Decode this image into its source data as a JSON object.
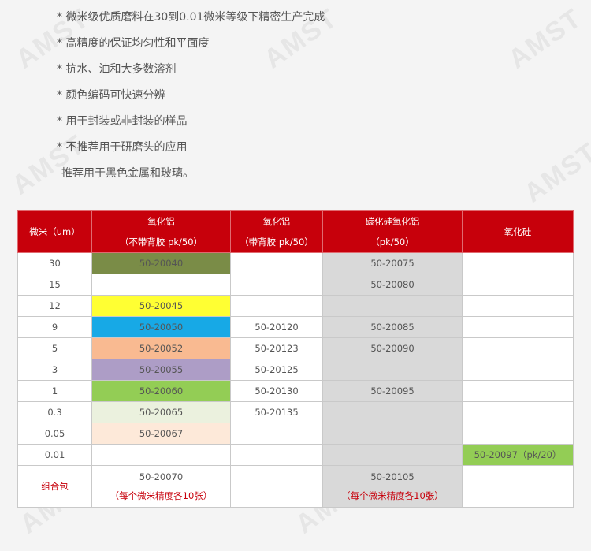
{
  "watermark": "AMST",
  "features": [
    "* 微米级优质磨料在30到0.01微米等级下精密生产完成",
    "* 高精度的保证均匀性和平面度",
    "* 抗水、油和大多数溶剂",
    "* 颜色编码可快速分辨",
    "* 用于封装或非封装的样品",
    "* 不推荐用于研磨头的应用",
    "推荐用于黑色金属和玻璃。"
  ],
  "table": {
    "headers": {
      "micron": "微米（um）",
      "alumina_nobacking_line1": "氧化铝",
      "alumina_nobacking_line2": "（不带背胶 pk/50）",
      "alumina_backing_line1": "氧化铝",
      "alumina_backing_line2": "（带背胶 pk/50）",
      "sic_alumina_line1": "碳化硅氧化铝",
      "sic_alumina_line2": "（pk/50）",
      "silica": "氧化硅"
    },
    "rows": [
      {
        "micron": "30",
        "a": "50-20040",
        "a_color": "#7a8c47",
        "b": "",
        "c": "50-20075",
        "d": ""
      },
      {
        "micron": "15",
        "a": "",
        "a_color": "#ffffff",
        "b": "",
        "c": "50-20080",
        "d": ""
      },
      {
        "micron": "12",
        "a": "50-20045",
        "a_color": "#ffff33",
        "b": "",
        "c": "",
        "d": ""
      },
      {
        "micron": "9",
        "a": "50-20050",
        "a_color": "#17a9e6",
        "b": "50-20120",
        "c": "50-20085",
        "d": ""
      },
      {
        "micron": "5",
        "a": "50-20052",
        "a_color": "#f9ba91",
        "b": "50-20123",
        "c": "50-20090",
        "d": ""
      },
      {
        "micron": "3",
        "a": "50-20055",
        "a_color": "#ad9dc6",
        "b": "50-20125",
        "c": "",
        "d": ""
      },
      {
        "micron": "1",
        "a": "50-20060",
        "a_color": "#93cd55",
        "b": "50-20130",
        "c": "50-20095",
        "d": ""
      },
      {
        "micron": "0.3",
        "a": "50-20065",
        "a_color": "#ebf1de",
        "b": "50-20135",
        "c": "",
        "d": ""
      },
      {
        "micron": "0.05",
        "a": "50-20067",
        "a_color": "#fde9d9",
        "b": "",
        "c": "",
        "d": ""
      },
      {
        "micron": "0.01",
        "a": "",
        "a_color": "#ffffff",
        "b": "",
        "c": "",
        "d": "50-20097（pk/20）",
        "d_color": "#93cd55"
      }
    ],
    "combo": {
      "label": "组合包",
      "a_code": "50-20070",
      "a_note": "（每个微米精度各10张）",
      "c_code": "50-20105",
      "c_note": "（每个微米精度各10张）"
    }
  },
  "colors": {
    "header_bg": "#c7000b",
    "sic_column_bg": "#d9d9d9",
    "combo_text": "#c7000b"
  }
}
